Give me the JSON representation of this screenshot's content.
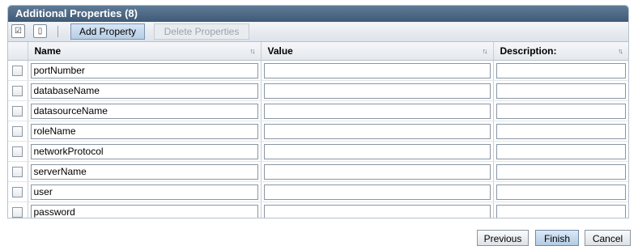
{
  "panel": {
    "title": "Additional Properties (8)"
  },
  "toolbar": {
    "add_label": "Add Property",
    "delete_label": "Delete Properties"
  },
  "table": {
    "headers": {
      "name": "Name",
      "value": "Value",
      "description": "Description:"
    },
    "rows": [
      {
        "name": "portNumber",
        "value": "",
        "description": ""
      },
      {
        "name": "databaseName",
        "value": "",
        "description": ""
      },
      {
        "name": "datasourceName",
        "value": "",
        "description": ""
      },
      {
        "name": "roleName",
        "value": "",
        "description": ""
      },
      {
        "name": "networkProtocol",
        "value": "",
        "description": ""
      },
      {
        "name": "serverName",
        "value": "",
        "description": ""
      },
      {
        "name": "user",
        "value": "",
        "description": ""
      },
      {
        "name": "password",
        "value": "",
        "description": ""
      }
    ]
  },
  "footer": {
    "previous_label": "Previous",
    "finish_label": "Finish",
    "cancel_label": "Cancel"
  },
  "icons": {
    "select_all": "select-all-icon",
    "deselect_all": "deselect-all-icon",
    "sort": "sort-icon"
  }
}
